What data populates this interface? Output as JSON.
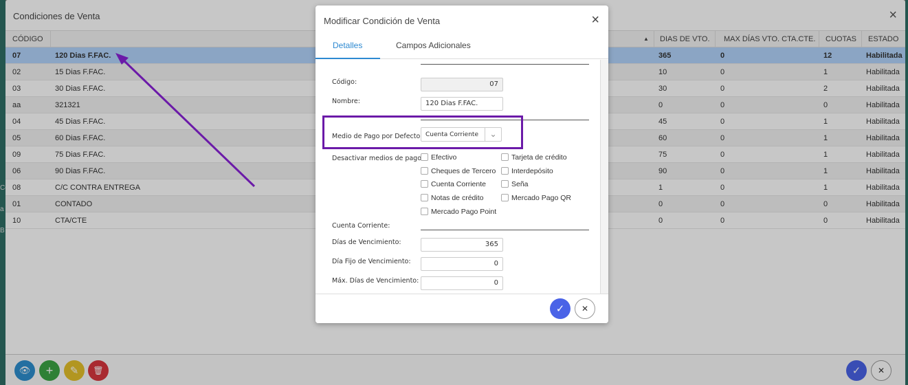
{
  "background": {
    "fragments": [
      "Co",
      "a",
      "B"
    ]
  },
  "panel": {
    "title": "Condiciones de Venta",
    "close_icon": "×",
    "headers": [
      "CÓDIGO",
      "",
      "DIAS DE VTO.",
      "MAX DÍAS VTO. CTA.CTE.",
      "CUOTAS",
      "ESTADO"
    ],
    "sort_icon": "▲",
    "rows": [
      {
        "codigo": "07",
        "nombre": "120 Dias F.FAC.",
        "dias": "365",
        "max": "0",
        "cuotas": "12",
        "estado": "Habilitada"
      },
      {
        "codigo": "02",
        "nombre": "15 Dias F.FAC.",
        "dias": "10",
        "max": "0",
        "cuotas": "1",
        "estado": "Habilitada"
      },
      {
        "codigo": "03",
        "nombre": "30 Dias F.FAC.",
        "dias": "30",
        "max": "0",
        "cuotas": "2",
        "estado": "Habilitada"
      },
      {
        "codigo": "aa",
        "nombre": "321321",
        "dias": "0",
        "max": "0",
        "cuotas": "0",
        "estado": "Habilitada"
      },
      {
        "codigo": "04",
        "nombre": "45 Dias F.FAC.",
        "dias": "45",
        "max": "0",
        "cuotas": "1",
        "estado": "Habilitada"
      },
      {
        "codigo": "05",
        "nombre": "60 Dias F.FAC.",
        "dias": "60",
        "max": "0",
        "cuotas": "1",
        "estado": "Habilitada"
      },
      {
        "codigo": "09",
        "nombre": "75 Dias F.FAC.",
        "dias": "75",
        "max": "0",
        "cuotas": "1",
        "estado": "Habilitada"
      },
      {
        "codigo": "06",
        "nombre": "90 Dias F.FAC.",
        "dias": "90",
        "max": "0",
        "cuotas": "1",
        "estado": "Habilitada"
      },
      {
        "codigo": "08",
        "nombre": "C/C CONTRA ENTREGA",
        "dias": "1",
        "max": "0",
        "cuotas": "1",
        "estado": "Habilitada"
      },
      {
        "codigo": "01",
        "nombre": "CONTADO",
        "dias": "0",
        "max": "0",
        "cuotas": "0",
        "estado": "Habilitada"
      },
      {
        "codigo": "10",
        "nombre": "CTA/CTE",
        "dias": "0",
        "max": "0",
        "cuotas": "0",
        "estado": "Habilitada"
      }
    ],
    "footer_buttons": {
      "view_icon": "👁",
      "add_icon": "+",
      "edit_icon": "✎",
      "delete_icon": "🗑",
      "confirm_icon": "✓",
      "cancel_icon": "✕"
    },
    "colors": {
      "view": "#2d8fcf",
      "add": "#3ca544",
      "edit": "#e5c02b",
      "delete": "#d9363e",
      "confirm": "#4a63e7"
    }
  },
  "modal": {
    "title": "Modificar Condición de Venta",
    "close_icon": "×",
    "tabs": [
      "Detalles",
      "Campos Adicionales"
    ],
    "fields": {
      "codigo_label": "Código:",
      "codigo_value": "07",
      "nombre_label": "Nombre:",
      "nombre_value": "120 Dias F.FAC.",
      "medio_label": "Medio de Pago por Defecto:",
      "medio_value": "Cuenta Corriente",
      "desactivar_label": "Desactivar medios de pago:",
      "cc_label": "Cuenta Corriente:",
      "dias_venc_label": "Días de Vencimiento:",
      "dias_venc_value": "365",
      "dia_fijo_label": "Día Fijo de Vencimiento:",
      "dia_fijo_value": "0",
      "max_dias_label": "Máx. Días de Vencimiento:",
      "max_dias_value": "0"
    },
    "checkboxes_left": [
      "Efectivo",
      "Cheques de Tercero",
      "Cuenta Corriente",
      "Notas de crédito",
      "Mercado Pago Point"
    ],
    "checkboxes_right": [
      "Tarjeta de crédito",
      "Interdepósito",
      "Seña",
      "Mercado Pago QR"
    ],
    "confirm_icon": "✓",
    "cancel_icon": "✕"
  },
  "annotation_color": "#6b1aa8"
}
